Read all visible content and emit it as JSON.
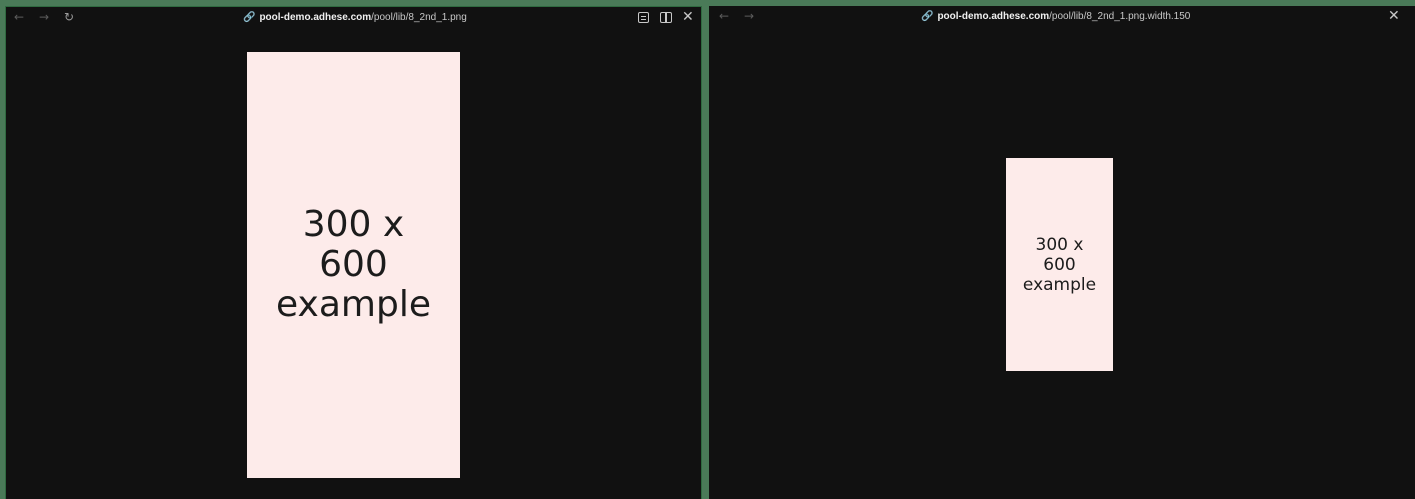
{
  "left_pane": {
    "nav": {
      "back_icon": "←",
      "forward_icon": "→",
      "reload_icon": "↻"
    },
    "url": {
      "link_icon": "🔗",
      "host": "pool-demo.adhese.com",
      "path": "/pool/lib/8_2nd_1.png"
    },
    "actions": {
      "close_icon": "✕"
    },
    "image": {
      "lines": [
        "300 x",
        "600",
        "example"
      ],
      "background": "#fdebea"
    }
  },
  "right_pane": {
    "nav": {
      "back_icon": "←",
      "forward_icon": "→"
    },
    "url": {
      "link_icon": "🔗",
      "host": "pool-demo.adhese.com",
      "path": "/pool/lib/8_2nd_1.png.width.150"
    },
    "actions": {
      "close_icon": "✕"
    },
    "image": {
      "lines": [
        "300 x",
        "600",
        "example"
      ],
      "background": "#fdebea"
    }
  },
  "colors": {
    "window_background": "#111111",
    "divider": "#4a7a58",
    "image_background": "#fdebea"
  }
}
